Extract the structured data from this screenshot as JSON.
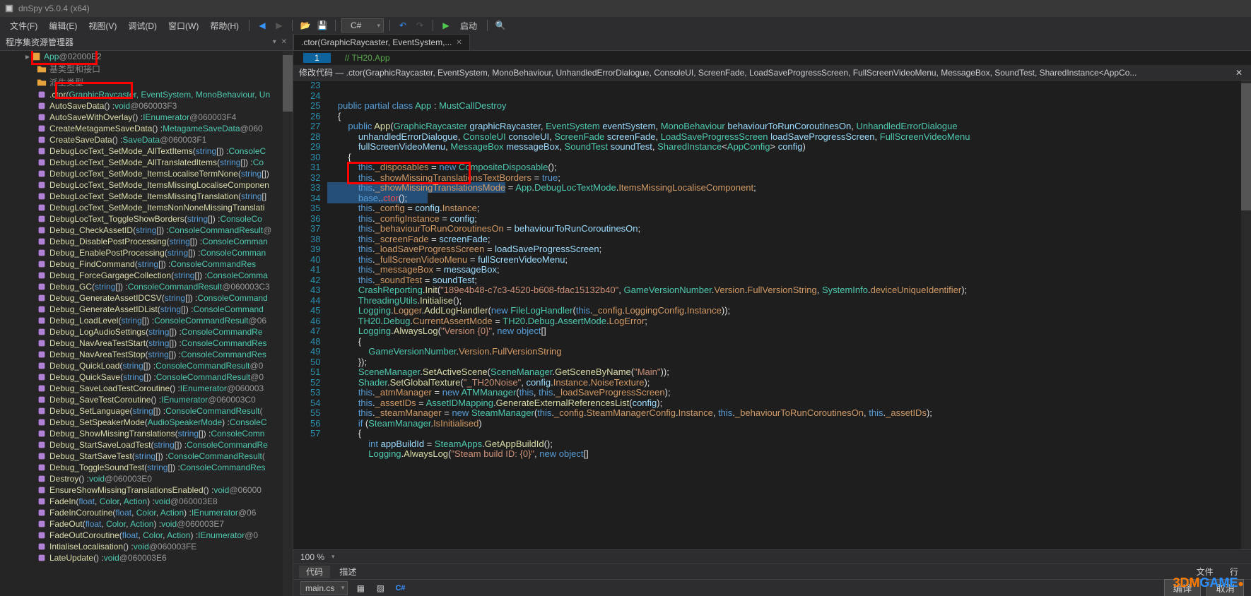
{
  "title": "dnSpy v5.0.4 (x64)",
  "menu": {
    "file": "文件(F)",
    "edit": "编辑(E)",
    "view": "视图(V)",
    "debug": "调试(D)",
    "window": "窗口(W)",
    "help": "帮助(H)",
    "lang": "C#",
    "start": "启动"
  },
  "left_panel_title": "程序集资源管理器",
  "tree_root": "App @02000E2",
  "tree_items": [
    "基类型和接口",
    "派生类型"
  ],
  "ctor_item": {
    "name": ".ctor",
    "params": "GraphicRaycaster, EventSystem, MonoBehaviour, Un",
    "rest": ""
  },
  "methods": [
    {
      "n": "AutoSaveData",
      "p": "() : ",
      "t": "void",
      "a": "@060003F3"
    },
    {
      "n": "AutoSaveWithOverlay",
      "p": "() : ",
      "t": "IEnumerator",
      "a": "@060003F4"
    },
    {
      "n": "CreateMetagameSaveData",
      "p": "() : ",
      "t": "MetagameSaveData",
      "a": "@060"
    },
    {
      "n": "CreateSaveData",
      "p": "() : ",
      "t": "SaveData",
      "a": "@060003F1"
    },
    {
      "n": "DebugLocText_SetMode_AllTextItems",
      "p": "(string[]) : ",
      "t": "ConsoleC",
      "a": ""
    },
    {
      "n": "DebugLocText_SetMode_AllTranslatedItems",
      "p": "(string[]) : ",
      "t": "Co",
      "a": ""
    },
    {
      "n": "DebugLocText_SetMode_ItemsLocaliseTermNone",
      "p": "(string[]) ",
      "t": "",
      "a": ""
    },
    {
      "n": "DebugLocText_SetMode_ItemsMissingLocaliseComponen",
      "p": "",
      "t": "",
      "a": ""
    },
    {
      "n": "DebugLocText_SetMode_ItemsMissingTranslation",
      "p": "(string[]",
      "t": "",
      "a": ""
    },
    {
      "n": "DebugLocText_SetMode_ItemsNonNoneMissingTranslati",
      "p": "",
      "t": "",
      "a": ""
    },
    {
      "n": "DebugLocText_ToggleShowBorders",
      "p": "(string[]) : ",
      "t": "ConsoleCo",
      "a": ""
    },
    {
      "n": "Debug_CheckAssetID",
      "p": "(string[]) : ",
      "t": "ConsoleCommandResult",
      "a": "@"
    },
    {
      "n": "Debug_DisablePostProcessing",
      "p": "(string[]) : ",
      "t": "ConsoleComman",
      "a": ""
    },
    {
      "n": "Debug_EnablePostProcessing",
      "p": "(string[]) : ",
      "t": "ConsoleComman",
      "a": ""
    },
    {
      "n": "Debug_FindCommand",
      "p": "(string[]) : ",
      "t": "ConsoleCommandRes",
      "a": ""
    },
    {
      "n": "Debug_ForceGargageCollection",
      "p": "(string[]) : ",
      "t": "ConsoleComma",
      "a": ""
    },
    {
      "n": "Debug_GC",
      "p": "(string[]) : ",
      "t": "ConsoleCommandResult",
      "a": "@060003C3"
    },
    {
      "n": "Debug_GenerateAssetIDCSV",
      "p": "(string[]) : ",
      "t": "ConsoleCommand",
      "a": ""
    },
    {
      "n": "Debug_GenerateAssetIDList",
      "p": "(string[]) : ",
      "t": "ConsoleCommand",
      "a": ""
    },
    {
      "n": "Debug_LoadLevel",
      "p": "(string[]) : ",
      "t": "ConsoleCommandResult",
      "a": "@06"
    },
    {
      "n": "Debug_LogAudioSettings",
      "p": "(string[]) : ",
      "t": "ConsoleCommandRe",
      "a": ""
    },
    {
      "n": "Debug_NavAreaTestStart",
      "p": "(string[]) : ",
      "t": "ConsoleCommandRes",
      "a": ""
    },
    {
      "n": "Debug_NavAreaTestStop",
      "p": "(string[]) : ",
      "t": "ConsoleCommandRes",
      "a": ""
    },
    {
      "n": "Debug_QuickLoad",
      "p": "(string[]) : ",
      "t": "ConsoleCommandResult",
      "a": "@0"
    },
    {
      "n": "Debug_QuickSave",
      "p": "(string[]) : ",
      "t": "ConsoleCommandResult",
      "a": "@0"
    },
    {
      "n": "Debug_SaveLoadTestCoroutine",
      "p": "() : ",
      "t": "IEnumerator",
      "a": "@060003"
    },
    {
      "n": "Debug_SaveTestCoroutine",
      "p": "() : ",
      "t": "IEnumerator",
      "a": "@060003C0"
    },
    {
      "n": "Debug_SetLanguage",
      "p": "(string[]) : ",
      "t": "ConsoleCommandResult",
      "a": "("
    },
    {
      "n": "Debug_SetSpeakerMode",
      "p": "(AudioSpeakerMode) : ",
      "t": "ConsoleC",
      "a": ""
    },
    {
      "n": "Debug_ShowMissingTranslations",
      "p": "(string[]) : ",
      "t": "ConsoleComn",
      "a": ""
    },
    {
      "n": "Debug_StartSaveLoadTest",
      "p": "(string[]) : ",
      "t": "ConsoleCommandRe",
      "a": ""
    },
    {
      "n": "Debug_StartSaveTest",
      "p": "(string[]) : ",
      "t": "ConsoleCommandResult",
      "a": "("
    },
    {
      "n": "Debug_ToggleSoundTest",
      "p": "(string[]) : ",
      "t": "ConsoleCommandRes",
      "a": ""
    },
    {
      "n": "Destroy",
      "p": "() : ",
      "t": "void",
      "a": "@060003E0"
    },
    {
      "n": "EnsureShowMissingTranslationsEnabled",
      "p": "() : ",
      "t": "void",
      "a": "@06000"
    },
    {
      "n": "FadeIn",
      "p": "(float, Color, Action) : ",
      "t": "void",
      "a": "@060003E8"
    },
    {
      "n": "FadeInCoroutine",
      "p": "(float, Color, Action) : ",
      "t": "IEnumerator",
      "a": "@06"
    },
    {
      "n": "FadeOut",
      "p": "(float, Color, Action) : ",
      "t": "void",
      "a": "@060003E7"
    },
    {
      "n": "FadeOutCoroutine",
      "p": "(float, Color, Action) : ",
      "t": "IEnumerator",
      "a": "@0"
    },
    {
      "n": "IntialiseLocalisation",
      "p": "() : ",
      "t": "void",
      "a": "@060003FE"
    },
    {
      "n": "LateUpdate",
      "p": "() : ",
      "t": "void",
      "a": "@060003E6"
    }
  ],
  "editor_tab": ".ctor(GraphicRaycaster, EventSystem,...",
  "crumb_num": "1",
  "crumb_txt": "// TH20.App",
  "modify_header": "修改代码 — .ctor(GraphicRaycaster, EventSystem, MonoBehaviour, UnhandledErrorDialogue, ConsoleUI, ScreenFade, LoadSaveProgressScreen, FullScreenVideoMenu, MessageBox, SoundTest, SharedInstance<AppCo...",
  "zoom": "100 %",
  "bottabs": {
    "code": "代码",
    "desc": "描述",
    "file": "文件",
    "line": "行"
  },
  "botcombo": "main.cs",
  "buttons": {
    "ok": "编译",
    "cancel": "取消"
  },
  "code_start": 23,
  "code_lines": [
    {
      "t": "    <k>public</k> <k>partial</k> <k>class</k> <ty>App</ty> : <ty>MustCallDestroy</ty>"
    },
    {
      "t": "    {"
    },
    {
      "t": "        <k>public</k> <m>App</m>(<ty>GraphicRaycaster</ty> <p>graphicRaycaster</p>, <ty>EventSystem</ty> <p>eventSystem</p>, <ty>MonoBehaviour</ty> <p>behaviourToRunCoroutinesOn</p>, <ty>UnhandledErrorDialogue</ty>"
    },
    {
      "t": "            <p>unhandledErrorDialogue</p>, <ty>ConsoleUI</ty> <p>consoleUI</p>, <ty>ScreenFade</ty> <p>screenFade</p>, <ty>LoadSaveProgressScreen</ty> <p>loadSaveProgressScreen</p>, <ty>FullScreenVideoMenu</ty>"
    },
    {
      "t": "            <p>fullScreenVideoMenu</p>, <ty>MessageBox</ty> <p>messageBox</p>, <ty>SoundTest</ty> <p>soundTest</p>, <ty>SharedInstance</ty>&lt;<ty>AppConfig</ty>&gt; <p>config</p>)"
    },
    {
      "t": "        {"
    },
    {
      "t": "            <k>this</k>.<f>_disposables</f> = <k>new</k> <ty>CompositeDisposable</ty>();"
    },
    {
      "t": "            <k>this</k>.<f>_showMissingTranslationsTextBorders</f> = <k>true</k>;"
    },
    {
      "t": "<sel>            <k>this</k>.<f>_showMissingTranslationsMode</f></sel> = <ty>App</ty>.<ty>DebugLocTextMode</ty>.<f>ItemsMissingLocaliseComponent</f>;",
      "hl": true
    },
    {
      "t": "<sel>            <k>base</k>..<err>ctor</err>();        </sel>",
      "hl": true
    },
    {
      "t": "            <k>this</k>.<f>_config</f> = <p>config</p>.<f>Instance</f>;"
    },
    {
      "t": "            <k>this</k>.<f>_configInstance</f> = <p>config</p>;"
    },
    {
      "t": "            <k>this</k>.<f>_behaviourToRunCoroutinesOn</f> = <p>behaviourToRunCoroutinesOn</p>;"
    },
    {
      "t": "            <k>this</k>.<f>_screenFade</f> = <p>screenFade</p>;"
    },
    {
      "t": "            <k>this</k>.<f>_loadSaveProgressScreen</f> = <p>loadSaveProgressScreen</p>;"
    },
    {
      "t": "            <k>this</k>.<f>_fullScreenVideoMenu</f> = <p>fullScreenVideoMenu</p>;"
    },
    {
      "t": "            <k>this</k>.<f>_messageBox</f> = <p>messageBox</p>;"
    },
    {
      "t": "            <k>this</k>.<f>_soundTest</f> = <p>soundTest</p>;"
    },
    {
      "t": "            <ty>CrashReporting</ty>.<m>Init</m>(<s>\"189e4b48-c7c3-4520-b608-fdac15132b40\"</s>, <ty>GameVersionNumber</ty>.<f>Version</f>.<f>FullVersionString</f>, <ty>SystemInfo</ty>.<f>deviceUniqueIdentifier</f>);"
    },
    {
      "t": "            <ty>ThreadingUtils</ty>.<m>Initialise</m>();"
    },
    {
      "t": "            <ty>Logging</ty>.<f>Logger</f>.<m>AddLogHandler</m>(<k>new</k> <ty>FileLogHandler</ty>(<k>this</k>.<f>_config</f>.<f>LoggingConfig</f>.<f>Instance</f>));"
    },
    {
      "t": "            <ty>TH20</ty>.<ty>Debug</ty>.<f>CurrentAssertMode</f> = <ty>TH20</ty>.<ty>Debug</ty>.<ty>AssertMode</ty>.<f>LogError</f>;"
    },
    {
      "t": "            <ty>Logging</ty>.<m>AlwaysLog</m>(<s>\"Version {0}\"</s>, <k>new</k> <k>object</k>[]"
    },
    {
      "t": "            {"
    },
    {
      "t": "                <ty>GameVersionNumber</ty>.<f>Version</f>.<f>FullVersionString</f>"
    },
    {
      "t": "            });"
    },
    {
      "t": "            <ty>SceneManager</ty>.<m>SetActiveScene</m>(<ty>SceneManager</ty>.<m>GetSceneByName</m>(<s>\"Main\"</s>));"
    },
    {
      "t": "            <ty>Shader</ty>.<m>SetGlobalTexture</m>(<s>\"_TH20Noise\"</s>, <p>config</p>.<f>Instance</f>.<f>NoiseTexture</f>);"
    },
    {
      "t": "            <k>this</k>.<f>_atmManager</f> = <k>new</k> <ty>ATMManager</ty>(<k>this</k>, <k>this</k>.<f>_loadSaveProgressScreen</f>);"
    },
    {
      "t": "            <k>this</k>.<f>_assetIDs</f> = <ty>AssetIDMapping</ty>.<m>GenerateExternalReferencesList</m>(<p>config</p>);"
    },
    {
      "t": "            <k>this</k>.<f>_steamManager</f> = <k>new</k> <ty>SteamManager</ty>(<k>this</k>.<f>_config</f>.<f>SteamManagerConfig</f>.<f>Instance</f>, <k>this</k>.<f>_behaviourToRunCoroutinesOn</f>, <k>this</k>.<f>_assetIDs</f>);"
    },
    {
      "t": "            <k>if</k> (<ty>SteamManager</ty>.<f>IsInitialised</f>)"
    },
    {
      "t": "            {"
    },
    {
      "t": "                <k>int</k> <p>appBuildId</p> = <ty>SteamApps</ty>.<m>GetAppBuildId</m>();"
    },
    {
      "t": "                <ty>Logging</ty>.<m>AlwaysLog</m>(<s>\"Steam build ID: {0}\"</s>, <k>new</k> <k>object</k>[]"
    }
  ]
}
